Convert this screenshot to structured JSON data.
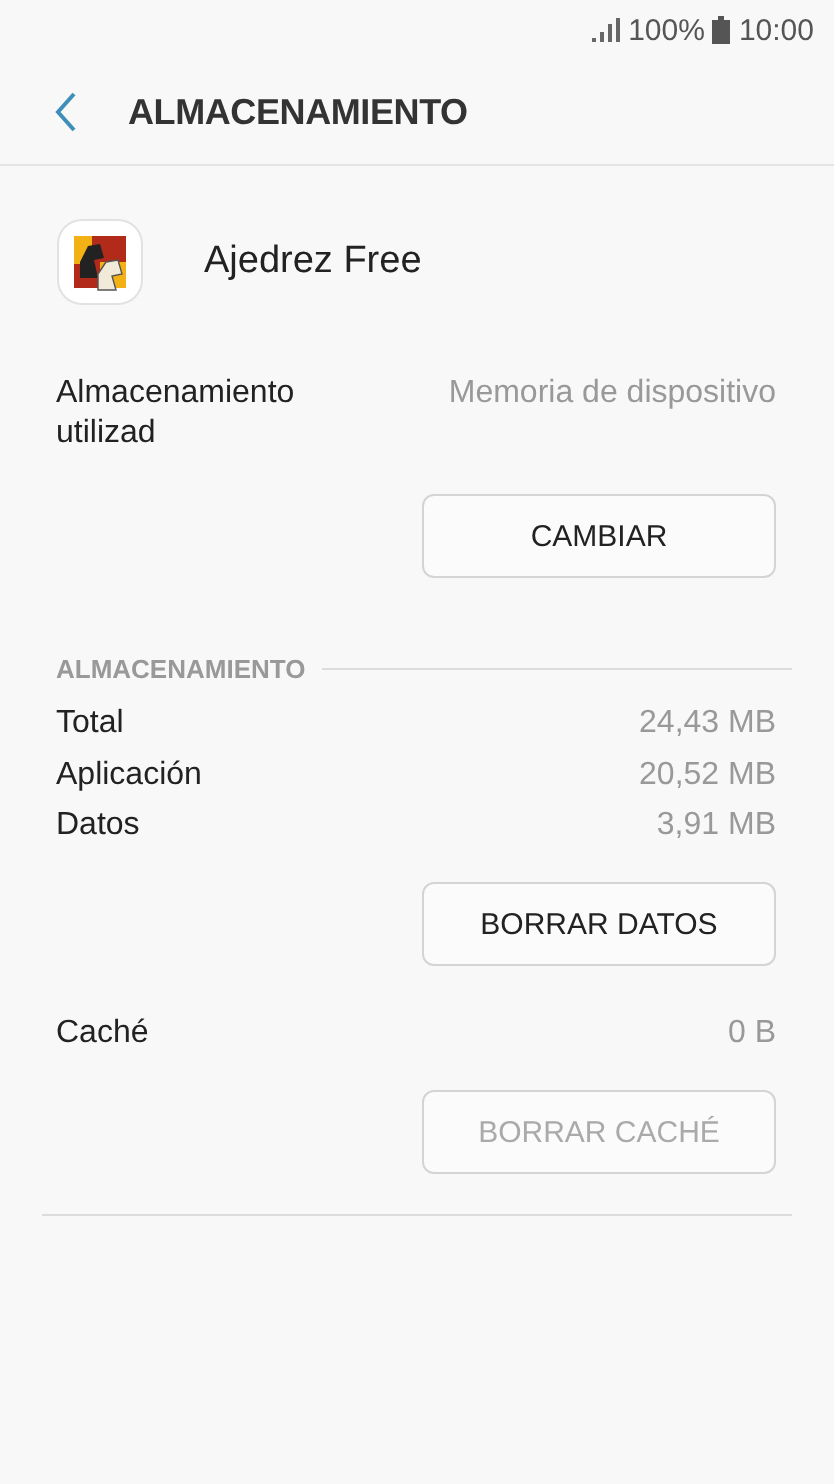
{
  "status_bar": {
    "battery": "100%",
    "time": "10:00"
  },
  "header": {
    "title": "ALMACENAMIENTO"
  },
  "app": {
    "name": "Ajedrez Free"
  },
  "storage_used": {
    "label": "Almacenamiento utilizad",
    "value": "Memoria de dispositivo",
    "button": {
      "label": "CAMBIAR",
      "disabled": false
    }
  },
  "section": {
    "title": "ALMACENAMIENTO",
    "rows": [
      {
        "label": "Total",
        "value": "24,43 MB"
      },
      {
        "label": "Aplicación",
        "value": "20,52 MB"
      },
      {
        "label": "Datos",
        "value": "3,91 MB"
      }
    ],
    "button": {
      "label": "BORRAR DATOS",
      "disabled": false
    }
  },
  "cache": {
    "label": "Caché",
    "value": "0 B",
    "button": {
      "label": "BORRAR CACHÉ",
      "disabled": true
    }
  }
}
